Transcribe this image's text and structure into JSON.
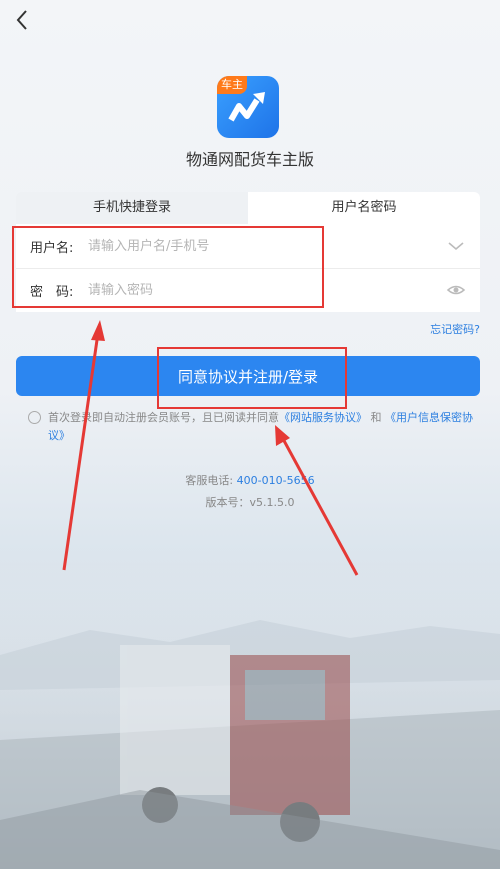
{
  "header": {
    "back_icon": "chevron-left-icon"
  },
  "app": {
    "badge": "车主",
    "name": "物通网配货车主版"
  },
  "tabs": [
    {
      "label": "手机快捷登录"
    },
    {
      "label": "用户名密码"
    }
  ],
  "form": {
    "username_label": "用户名:",
    "username_placeholder": "请输入用户名/手机号",
    "password_label": "密　码:",
    "password_placeholder": "请输入密码"
  },
  "forgot_label": "忘记密码?",
  "login_label": "同意协议并注册/登录",
  "agreement": {
    "text": "首次登录即自动注册会员账号，且已阅读并同意",
    "link1": "《网站服务协议》",
    "and": "和",
    "link2": "《用户信息保密协议》"
  },
  "service": {
    "phone_label": "客服电话:",
    "phone": "400-010-5656",
    "version": "版本号：v5.1.5.0"
  },
  "colors": {
    "primary": "#2c86f0",
    "link": "#2c7fe0",
    "annotation": "#e53935",
    "badge": "#ff7a1a"
  }
}
